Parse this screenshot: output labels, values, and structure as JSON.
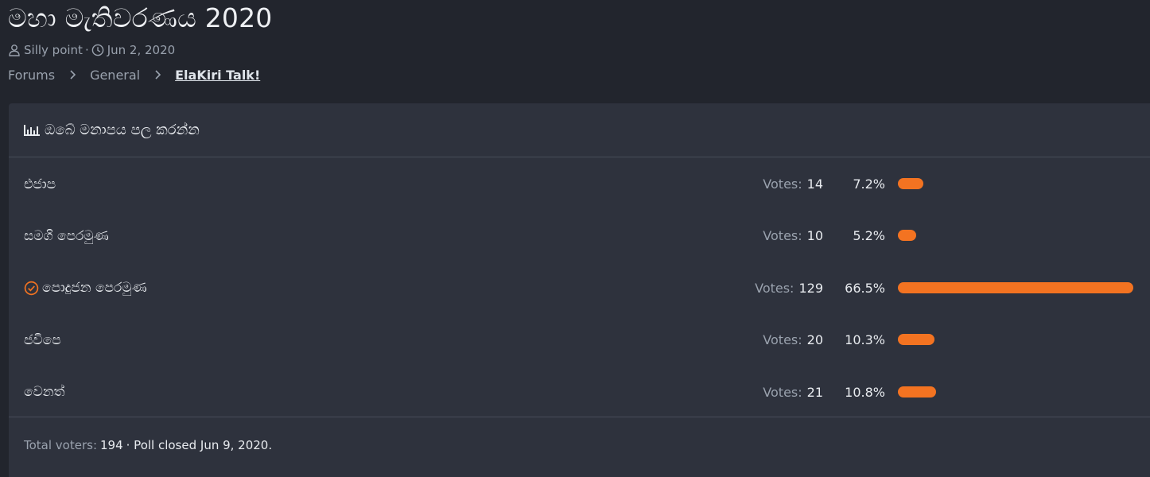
{
  "thread": {
    "title": "මහා මැතිවරණය 2020",
    "author": "Silly point",
    "date": "Jun 2, 2020"
  },
  "breadcrumb": [
    "Forums",
    "General",
    "ElaKiri Talk!"
  ],
  "poll": {
    "question": "ඔබේ මනාපය පල කරන්න",
    "votes_label": "Votes:",
    "bar_color": "#f37321",
    "responses": [
      {
        "label": "එජාප",
        "votes": "14",
        "percent": "7.2%",
        "fraction": 0.072,
        "voted": false
      },
      {
        "label": "සමගි පෙරමුණ",
        "votes": "10",
        "percent": "5.2%",
        "fraction": 0.052,
        "voted": false
      },
      {
        "label": "පොදුජන පෙරමුණ",
        "votes": "129",
        "percent": "66.5%",
        "fraction": 0.665,
        "voted": true
      },
      {
        "label": "ජවිපෙ",
        "votes": "20",
        "percent": "10.3%",
        "fraction": 0.103,
        "voted": false
      },
      {
        "label": "වෙනත්",
        "votes": "21",
        "percent": "10.8%",
        "fraction": 0.108,
        "voted": false
      }
    ],
    "footer": {
      "voters_label": "Total voters:",
      "voters_value": "194",
      "closed_text": "· Poll closed Jun 9, 2020."
    }
  }
}
